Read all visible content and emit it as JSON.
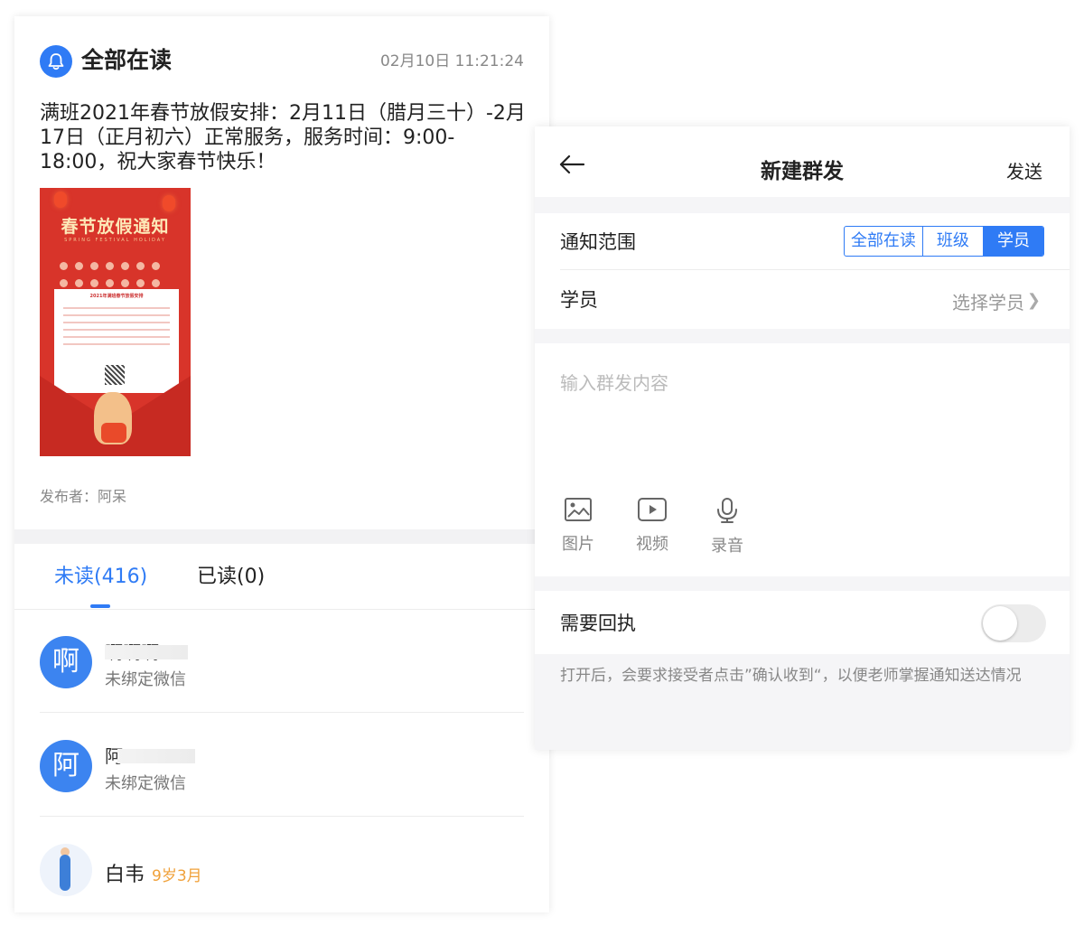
{
  "left": {
    "header": {
      "title": "全部在读",
      "time": "02月10日 11:21:24",
      "icon": "bell-icon"
    },
    "body": "满班2021年春节放假安排：2月11日（腊月三十）-2月17日（正月初六）正常服务，服务时间：9:00-18:00，祝大家春节快乐！",
    "poster": {
      "title": "春节放假通知",
      "subtitle": "SPRING FESTIVAL HOLIDAY",
      "letter_title": "2021年满班春节放假安排"
    },
    "publisher": "发布者：阿呆",
    "tabs": [
      {
        "label": "未读(416)"
      },
      {
        "label": "已读(0)"
      }
    ],
    "rows": [
      {
        "avatar": "啊",
        "name": "啊啊啊",
        "sub": "未绑定微信"
      },
      {
        "avatar": "阿",
        "name": "阿",
        "sub": "未绑定微信"
      },
      {
        "name": "白韦",
        "age": "9岁3月"
      }
    ]
  },
  "right": {
    "header": {
      "title": "新建群发",
      "send": "发送"
    },
    "scope": {
      "label": "通知范围",
      "options": [
        "全部在读",
        "班级",
        "学员"
      ],
      "selected": "学员"
    },
    "student": {
      "label": "学员",
      "value": "选择学员"
    },
    "content": {
      "placeholder": "输入群发内容"
    },
    "tools": [
      {
        "icon": "image-icon",
        "label": "图片"
      },
      {
        "icon": "video-icon",
        "label": "视频"
      },
      {
        "icon": "microphone-icon",
        "label": "录音"
      }
    ],
    "receipt": {
      "label": "需要回执",
      "enabled": false
    },
    "note": "打开后，会要求接受者点击”确认收到“，以便老师掌握通知送达情况"
  }
}
